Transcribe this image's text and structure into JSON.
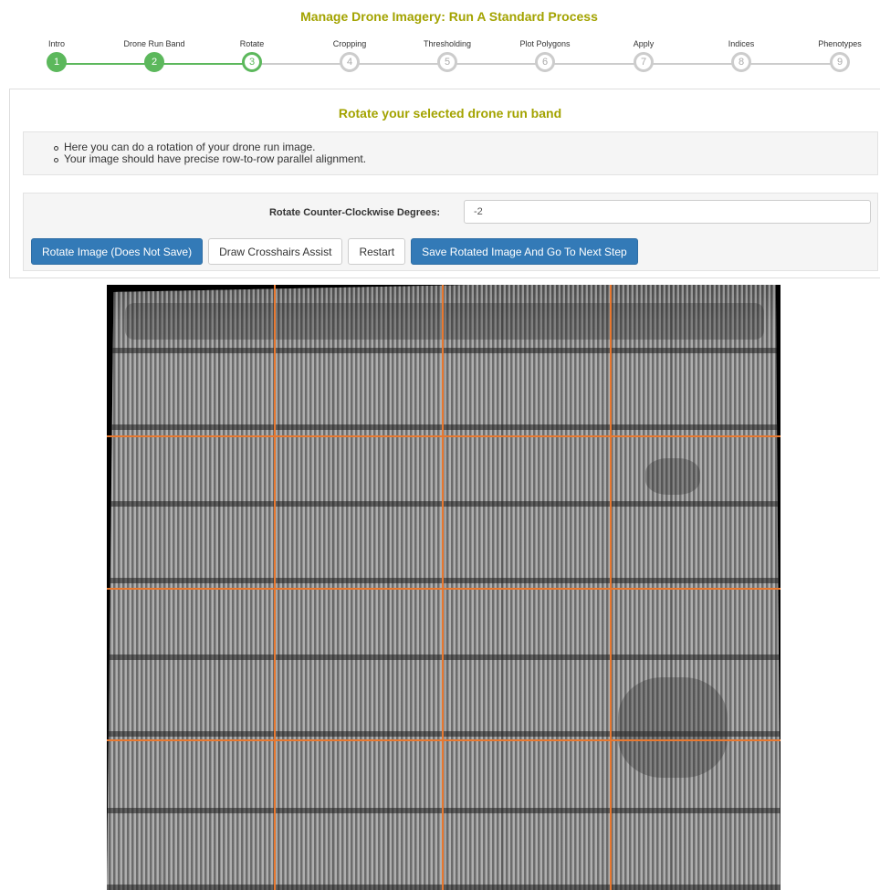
{
  "page": {
    "title": "Manage Drone Imagery: Run A Standard Process"
  },
  "stepper": {
    "steps": [
      {
        "label": "Intro",
        "number": "1",
        "state": "done"
      },
      {
        "label": "Drone Run Band",
        "number": "2",
        "state": "done"
      },
      {
        "label": "Rotate",
        "number": "3",
        "state": "current"
      },
      {
        "label": "Cropping",
        "number": "4",
        "state": "todo"
      },
      {
        "label": "Thresholding",
        "number": "5",
        "state": "todo"
      },
      {
        "label": "Plot Polygons",
        "number": "6",
        "state": "todo"
      },
      {
        "label": "Apply",
        "number": "7",
        "state": "todo"
      },
      {
        "label": "Indices",
        "number": "8",
        "state": "todo"
      },
      {
        "label": "Phenotypes",
        "number": "9",
        "state": "todo"
      }
    ],
    "colors": {
      "done": "#5cb85c",
      "todo": "#cccccc"
    }
  },
  "panel": {
    "title": "Rotate your selected drone run band",
    "info": [
      "Here you can do a rotation of your drone run image.",
      "Your image should have precise row-to-row parallel alignment."
    ],
    "form": {
      "rotate_label": "Rotate Counter-Clockwise Degrees:",
      "rotate_value": "-2"
    },
    "buttons": {
      "rotate": "Rotate Image (Does Not Save)",
      "crosshairs": "Draw Crosshairs Assist",
      "restart": "Restart",
      "save_next": "Save Rotated Image And Go To Next Step"
    }
  },
  "image": {
    "crosshair_color": "#e8782f"
  }
}
